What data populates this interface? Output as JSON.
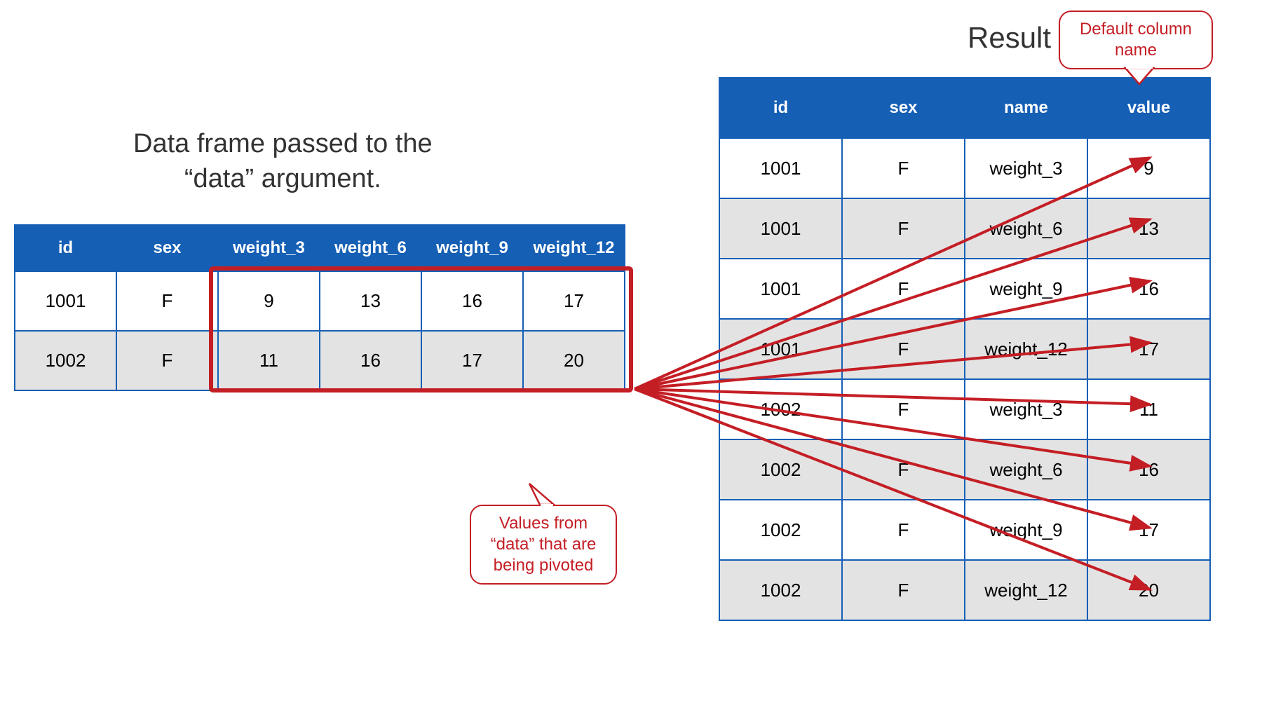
{
  "titles": {
    "left_line1": "Data frame passed to the",
    "left_line2": "“data” argument.",
    "right": "Result"
  },
  "callouts": {
    "top_line1": "Default column",
    "top_line2": "name",
    "bottom_line1": "Values from",
    "bottom_line2": "“data” that are",
    "bottom_line3": "being pivoted"
  },
  "left_table": {
    "headers": [
      "id",
      "sex",
      "weight_3",
      "weight_6",
      "weight_9",
      "weight_12"
    ],
    "rows": [
      [
        "1001",
        "F",
        "9",
        "13",
        "16",
        "17"
      ],
      [
        "1002",
        "F",
        "11",
        "16",
        "17",
        "20"
      ]
    ]
  },
  "right_table": {
    "headers": [
      "id",
      "sex",
      "name",
      "value"
    ],
    "rows": [
      [
        "1001",
        "F",
        "weight_3",
        "9"
      ],
      [
        "1001",
        "F",
        "weight_6",
        "13"
      ],
      [
        "1001",
        "F",
        "weight_9",
        "16"
      ],
      [
        "1001",
        "F",
        "weight_12",
        "17"
      ],
      [
        "1002",
        "F",
        "weight_3",
        "11"
      ],
      [
        "1002",
        "F",
        "weight_6",
        "16"
      ],
      [
        "1002",
        "F",
        "weight_9",
        "17"
      ],
      [
        "1002",
        "F",
        "weight_12",
        "20"
      ]
    ]
  },
  "colors": {
    "header_bg": "#155fb5",
    "highlight": "#c41e25",
    "alt_row": "#e3e3e3"
  }
}
